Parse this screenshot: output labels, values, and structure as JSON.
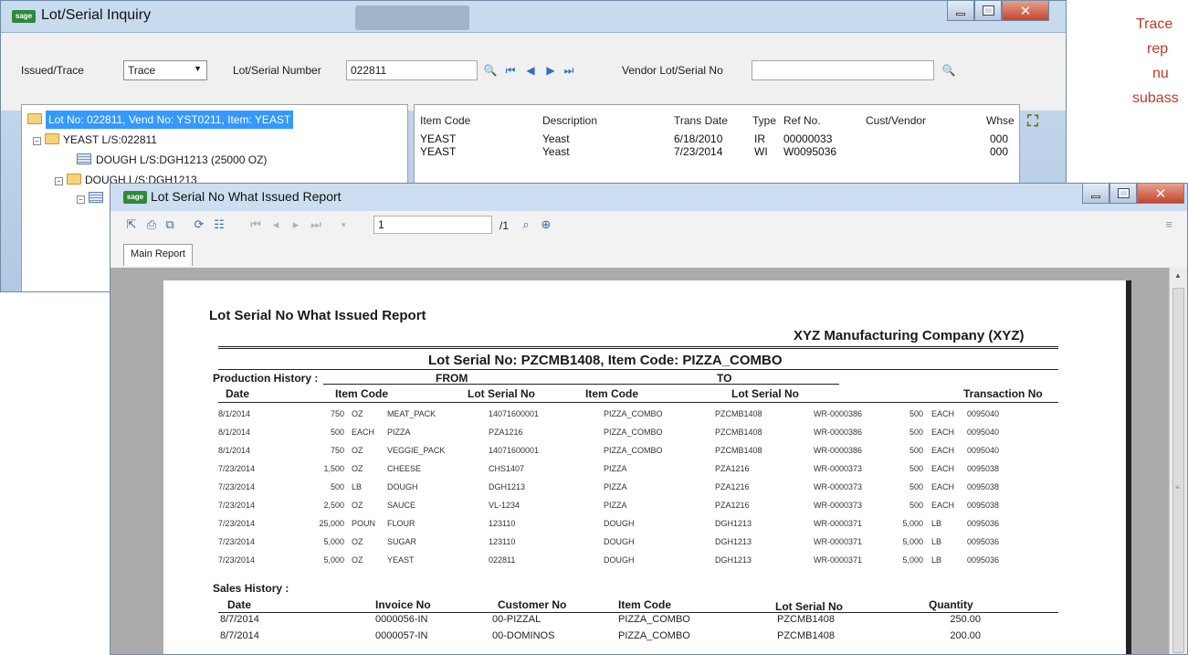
{
  "inquiry_window": {
    "title": "Lot/Serial Inquiry",
    "issued_trace_label": "Issued/Trace",
    "issued_trace_value": "Trace",
    "lot_serial_label": "Lot/Serial Number",
    "lot_serial_value": "022811",
    "vendor_lot_label": "Vendor Lot/Serial No",
    "vendor_lot_value": "",
    "tree": [
      "Lot No: 022811, Vend No: YST0211, Item: YEAST",
      "YEAST L/S:022811",
      "DOUGH L/S:DGH1213 (25000 OZ)",
      "DOUGH L/S:DGH1213"
    ],
    "grid_columns": [
      "Item Code",
      "Description",
      "Trans Date",
      "Type",
      "Ref No.",
      "Cust/Vendor",
      "Whse"
    ],
    "grid_rows": [
      [
        "YEAST",
        "Yeast",
        "6/18/2010",
        "IR",
        "00000033",
        "",
        "000"
      ],
      [
        "YEAST",
        "Yeast",
        "7/23/2014",
        "WI",
        "W0095036",
        "",
        "000"
      ]
    ]
  },
  "annotation": [
    "Trace",
    "rep",
    "nu",
    "subass"
  ],
  "report_window": {
    "title": "Lot Serial No What Issued Report",
    "page_value": "1",
    "page_total": "/1",
    "tab_label": "Main Report"
  },
  "report": {
    "title": "Lot Serial No What Issued Report",
    "company": "XYZ Manufacturing Company (XYZ)",
    "lot_header": "Lot Serial No: PZCMB1408, Item Code: PIZZA_COMBO",
    "production_label": "Production History :",
    "from_label": "FROM",
    "to_label": "TO",
    "prod_columns": [
      "Date",
      "Item Code",
      "Lot Serial No",
      "Item Code",
      "Lot Serial No",
      "Transaction No"
    ],
    "prod_rows": [
      [
        "8/1/2014",
        "750",
        "OZ",
        "MEAT_PACK",
        "14071600001",
        "PIZZA_COMBO",
        "PZCMB1408",
        "WR-0000386",
        "500",
        "EACH",
        "0095040"
      ],
      [
        "8/1/2014",
        "500",
        "EACH",
        "PIZZA",
        "PZA1216",
        "PIZZA_COMBO",
        "PZCMB1408",
        "WR-0000386",
        "500",
        "EACH",
        "0095040"
      ],
      [
        "8/1/2014",
        "750",
        "OZ",
        "VEGGIE_PACK",
        "14071600001",
        "PIZZA_COMBO",
        "PZCMB1408",
        "WR-0000386",
        "500",
        "EACH",
        "0095040"
      ],
      [
        "7/23/2014",
        "1,500",
        "OZ",
        "CHEESE",
        "CHS1407",
        "PIZZA",
        "PZA1216",
        "WR-0000373",
        "500",
        "EACH",
        "0095038"
      ],
      [
        "7/23/2014",
        "500",
        "LB",
        "DOUGH",
        "DGH1213",
        "PIZZA",
        "PZA1216",
        "WR-0000373",
        "500",
        "EACH",
        "0095038"
      ],
      [
        "7/23/2014",
        "2,500",
        "OZ",
        "SAUCE",
        "VL-1234",
        "PIZZA",
        "PZA1216",
        "WR-0000373",
        "500",
        "EACH",
        "0095038"
      ],
      [
        "7/23/2014",
        "25,000",
        "POUN",
        "FLOUR",
        "123110",
        "DOUGH",
        "DGH1213",
        "WR-0000371",
        "5,000",
        "LB",
        "0095036"
      ],
      [
        "7/23/2014",
        "5,000",
        "OZ",
        "SUGAR",
        "123110",
        "DOUGH",
        "DGH1213",
        "WR-0000371",
        "5,000",
        "LB",
        "0095036"
      ],
      [
        "7/23/2014",
        "5,000",
        "OZ",
        "YEAST",
        "022811",
        "DOUGH",
        "DGH1213",
        "WR-0000371",
        "5,000",
        "LB",
        "0095036"
      ]
    ],
    "sales_label": "Sales History :",
    "sales_columns": [
      "Date",
      "Invoice No",
      "Customer No",
      "Item Code",
      "Lot Serial No",
      "Quantity"
    ],
    "sales_rows": [
      [
        "8/7/2014",
        "0000056-IN",
        "00-PIZZAL",
        "PIZZA_COMBO",
        "PZCMB1408",
        "250.00"
      ],
      [
        "8/7/2014",
        "0000057-IN",
        "00-DOMINOS",
        "PIZZA_COMBO",
        "PZCMB1408",
        "200.00"
      ]
    ]
  },
  "colors": {
    "selection": "#3399ff",
    "annotation": "#c0392b",
    "close_button": "#c4452c"
  }
}
